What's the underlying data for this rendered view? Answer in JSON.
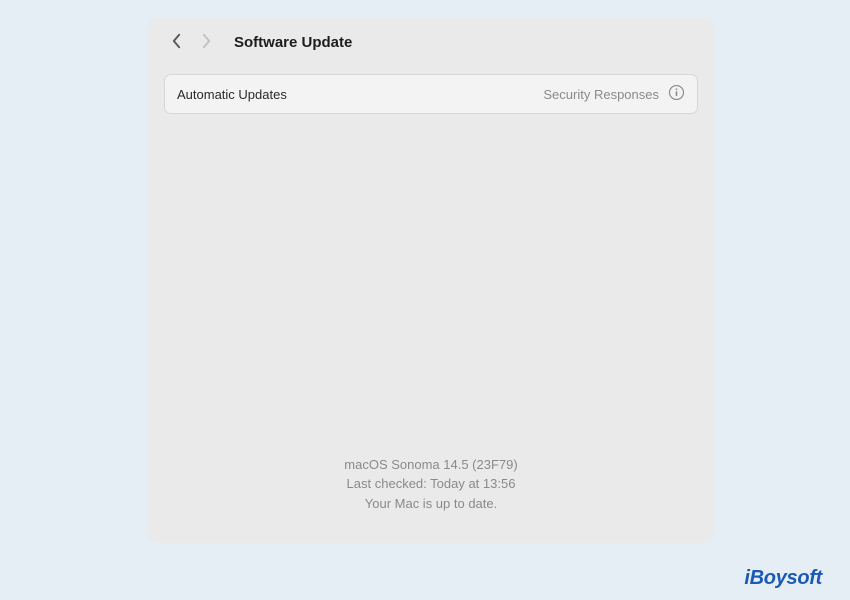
{
  "header": {
    "title": "Software Update"
  },
  "row": {
    "label": "Automatic Updates",
    "value": "Security Responses"
  },
  "status": {
    "os_version": "macOS Sonoma 14.5 (23F79)",
    "last_checked": "Last checked: Today at 13:56",
    "up_to_date": "Your Mac is up to date."
  },
  "watermark": "iBoysoft",
  "colors": {
    "page_bg": "#e5edf5",
    "window_bg": "#ebeaea",
    "row_bg": "#f4f3f3",
    "row_border": "#d8d7d6",
    "text_primary": "#1d1d1d",
    "text_secondary": "#8a8a8a",
    "watermark": "#1a5ab4"
  }
}
